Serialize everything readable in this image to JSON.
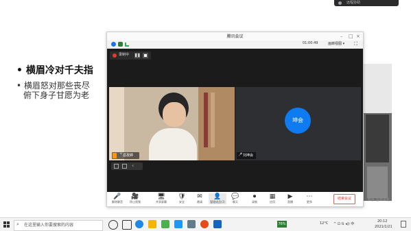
{
  "remote_bar": {
    "label": "远程协助"
  },
  "slide": {
    "bullet1": "横眉冷对千夫指",
    "bullet2_line1": "横眉怒对那些丧尽",
    "bullet2_line2": "俯下身子甘愿为老"
  },
  "meeting": {
    "title": "腾讯会议",
    "timer": "01:00:49",
    "view_label": "画廊视图",
    "recording_label": "录制中",
    "participant_left": "岳孜婷",
    "participant_right": "刘坤会",
    "avatar_text": "坤会",
    "toolbar": [
      {
        "icon": "🎤",
        "label": "解除静音"
      },
      {
        "icon": "🎥",
        "label": "停止视频"
      },
      {
        "icon": "🖥",
        "label": "共享屏幕"
      },
      {
        "icon": "🛡",
        "label": "安全"
      },
      {
        "icon": "✉",
        "label": "邀请"
      },
      {
        "icon": "👤",
        "label": "管理成员(3)"
      },
      {
        "icon": "💬",
        "label": "聊天"
      },
      {
        "icon": "⏺",
        "label": "录制"
      },
      {
        "icon": "▦",
        "label": "应用"
      },
      {
        "icon": "▶",
        "label": "直播"
      },
      {
        "icon": "⋯",
        "label": "更多"
      }
    ],
    "end_button": "结束会议"
  },
  "photo_watermark": "知乎 @辛泽光",
  "taskbar": {
    "search_placeholder": "在这里输入你要搜索的内容",
    "temperature": "12°C",
    "time": "20:12",
    "date": "2021/1/21",
    "badge": "76%"
  }
}
